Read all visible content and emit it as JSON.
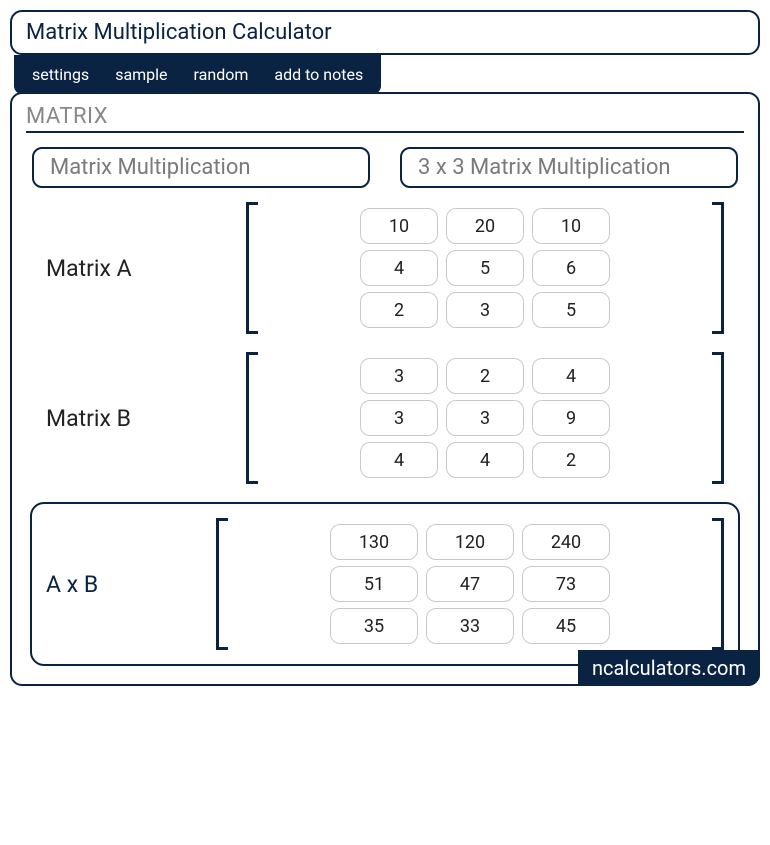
{
  "title": "Matrix Multiplication Calculator",
  "tabs": {
    "settings": "settings",
    "sample": "sample",
    "random": "random",
    "notes": "add to notes"
  },
  "section": "MATRIX",
  "modes": {
    "a": "Matrix Multiplication",
    "b": "3 x 3 Matrix Multiplication"
  },
  "labelA": "Matrix A",
  "labelB": "Matrix B",
  "labelR": "A x B",
  "A": {
    "r0c0": "10",
    "r0c1": "20",
    "r0c2": "10",
    "r1c0": "4",
    "r1c1": "5",
    "r1c2": "6",
    "r2c0": "2",
    "r2c1": "3",
    "r2c2": "5"
  },
  "B": {
    "r0c0": "3",
    "r0c1": "2",
    "r0c2": "4",
    "r1c0": "3",
    "r1c1": "3",
    "r1c2": "9",
    "r2c0": "4",
    "r2c1": "4",
    "r2c2": "2"
  },
  "R": {
    "r0c0": "130",
    "r0c1": "120",
    "r0c2": "240",
    "r1c0": "51",
    "r1c1": "47",
    "r1c2": "73",
    "r2c0": "35",
    "r2c1": "33",
    "r2c2": "45"
  },
  "brand": "ncalculators.com"
}
